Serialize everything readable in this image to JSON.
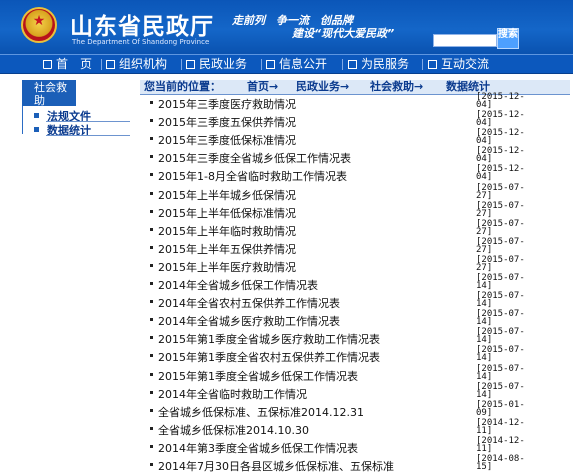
{
  "header": {
    "site_title": "山东省民政厅",
    "site_subtitle": "The Department Of Shandong Province",
    "slogan_line1": "走前列　争一流　创品牌",
    "slogan_line2": "建设“现代大爱民政”",
    "search_button": "搜索"
  },
  "nav": {
    "items": [
      {
        "label": "首　页"
      },
      {
        "label": "组织机构"
      },
      {
        "label": "民政业务"
      },
      {
        "label": "信息公开"
      },
      {
        "label": "为民服务"
      },
      {
        "label": "互动交流"
      }
    ]
  },
  "sidebar": {
    "title": "社会救助",
    "items": [
      {
        "label": "法规文件"
      },
      {
        "label": "数据统计"
      }
    ]
  },
  "breadcrumb": {
    "prefix": "您当前的位置：",
    "home": "首页→",
    "level1": "民政业务→",
    "level2": "社会救助→",
    "current": "数据统计"
  },
  "list": [
    {
      "title": "2015年三季度医疗救助情况",
      "date": "[2015-12-04]"
    },
    {
      "title": "2015年三季度五保供养情况",
      "date": "[2015-12-04]"
    },
    {
      "title": "2015年三季度低保标准情况",
      "date": "[2015-12-04]"
    },
    {
      "title": "2015年三季度全省城乡低保工作情况表",
      "date": "[2015-12-04]"
    },
    {
      "title": "2015年1-8月全省临时救助工作情况表",
      "date": "[2015-12-04]"
    },
    {
      "title": "2015年上半年城乡低保情况",
      "date": "[2015-07-27]"
    },
    {
      "title": "2015年上半年低保标准情况",
      "date": "[2015-07-27]"
    },
    {
      "title": "2015年上半年临时救助情况",
      "date": "[2015-07-27]"
    },
    {
      "title": "2015年上半年五保供养情况",
      "date": "[2015-07-27]"
    },
    {
      "title": "2015年上半年医疗救助情况",
      "date": "[2015-07-27]"
    },
    {
      "title": "2014年全省城乡低保工作情况表",
      "date": "[2015-07-14]"
    },
    {
      "title": "2014年全省农村五保供养工作情况表",
      "date": "[2015-07-14]"
    },
    {
      "title": "2014年全省城乡医疗救助工作情况表",
      "date": "[2015-07-14]"
    },
    {
      "title": "2015年第1季度全省城乡医疗救助工作情况表",
      "date": "[2015-07-14]"
    },
    {
      "title": "2015年第1季度全省农村五保供养工作情况表",
      "date": "[2015-07-14]"
    },
    {
      "title": "2015年第1季度全省城乡低保工作情况表",
      "date": "[2015-07-14]"
    },
    {
      "title": "2014年全省临时救助工作情况",
      "date": "[2015-07-14]"
    },
    {
      "title": "全省城乡低保标准、五保标准2014.12.31",
      "date": "[2015-01-09]"
    },
    {
      "title": "全省城乡低保标准2014.10.30",
      "date": "[2014-12-11]"
    },
    {
      "title": "2014年第3季度全省城乡低保工作情况表",
      "date": "[2014-12-11]"
    },
    {
      "title": "2014年7月30日各县区城乡低保标准、五保标准",
      "date": "[2014-08-15]"
    }
  ],
  "colors": {
    "header_blue": "#0b56b8",
    "nav_blue": "#0c58bd",
    "crumb_bg": "#dce8f7",
    "link_blue": "#0a3a8e"
  }
}
